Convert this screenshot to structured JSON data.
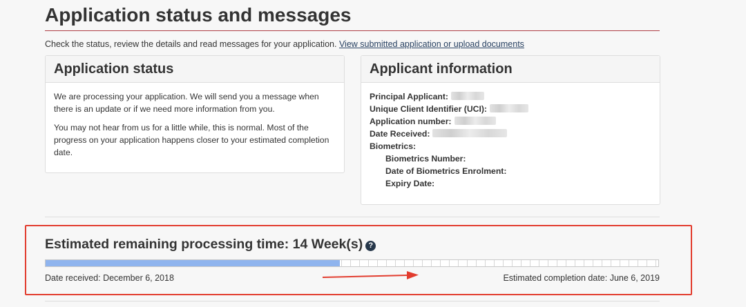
{
  "page": {
    "title": "Application status and messages",
    "intro_text": "Check the status, review the details and read messages for your application.",
    "intro_link": "View submitted application or upload documents"
  },
  "status_panel": {
    "heading": "Application status",
    "paragraph1": "We are processing your application. We will send you a message when there is an update or if we need more information from you.",
    "paragraph2": "You may not hear from us for a little while, this is normal. Most of the progress on your application happens closer to your estimated completion date."
  },
  "applicant_panel": {
    "heading": "Applicant information",
    "principal_applicant_label": "Principal Applicant:",
    "uci_label": "Unique Client Identifier (UCI):",
    "application_number_label": "Application number:",
    "date_received_label": "Date Received:",
    "biometrics_label": "Biometrics:",
    "biometrics_number_label": "Biometrics Number:",
    "biometrics_enrolment_label": "Date of Biometrics Enrolment:",
    "expiry_date_label": "Expiry Date:"
  },
  "processing": {
    "title": "Estimated remaining processing time: 14 Week(s)",
    "help_icon": "question-circle-icon",
    "progress_fraction": 0.48,
    "date_received_text": "Date received: December 6, 2018",
    "completion_text": "Estimated completion date: June 6, 2019"
  },
  "colors": {
    "accent_rule": "#af3c43",
    "progress_fill": "#8fb4ee",
    "annotation_red": "#e23c2e",
    "help_icon_bg": "#26374a"
  }
}
